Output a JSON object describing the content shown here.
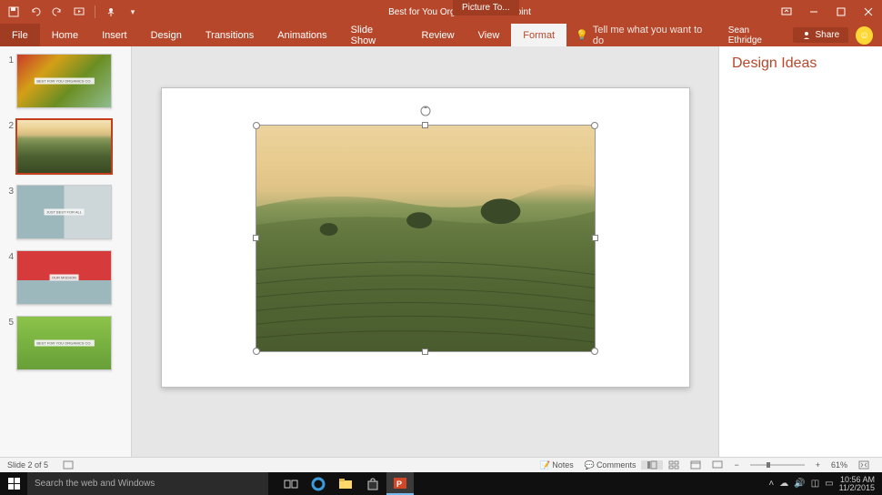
{
  "titlebar": {
    "title": "Best for You Organics - PowerPoint",
    "context_tab": "Picture To..."
  },
  "ribbon": {
    "file": "File",
    "tabs": [
      "Home",
      "Insert",
      "Design",
      "Transitions",
      "Animations",
      "Slide Show",
      "Review",
      "View",
      "Format"
    ],
    "active": "Format",
    "tell_me": "Tell me what you want to do",
    "user": "Sean Ethridge",
    "share": "Share"
  },
  "thumbnails": [
    {
      "n": "1",
      "kind": "veggies",
      "label": "BEST FOR YOU ORGANICS CO."
    },
    {
      "n": "2",
      "kind": "vineyard",
      "selected": true
    },
    {
      "n": "3",
      "kind": "cabbage",
      "label": "JUST BEST FOR ALL"
    },
    {
      "n": "4",
      "kind": "tomato",
      "label": "OUR MISSION"
    },
    {
      "n": "5",
      "kind": "peas",
      "label": "BEST FOR YOU ORGANICS CO."
    }
  ],
  "design_pane": {
    "title": "Design Ideas"
  },
  "status": {
    "slide": "Slide 2 of 5",
    "notes": "Notes",
    "comments": "Comments",
    "zoom": "61%"
  },
  "taskbar": {
    "search": "Search the web and Windows",
    "time": "10:56 AM",
    "date": "11/2/2015"
  }
}
